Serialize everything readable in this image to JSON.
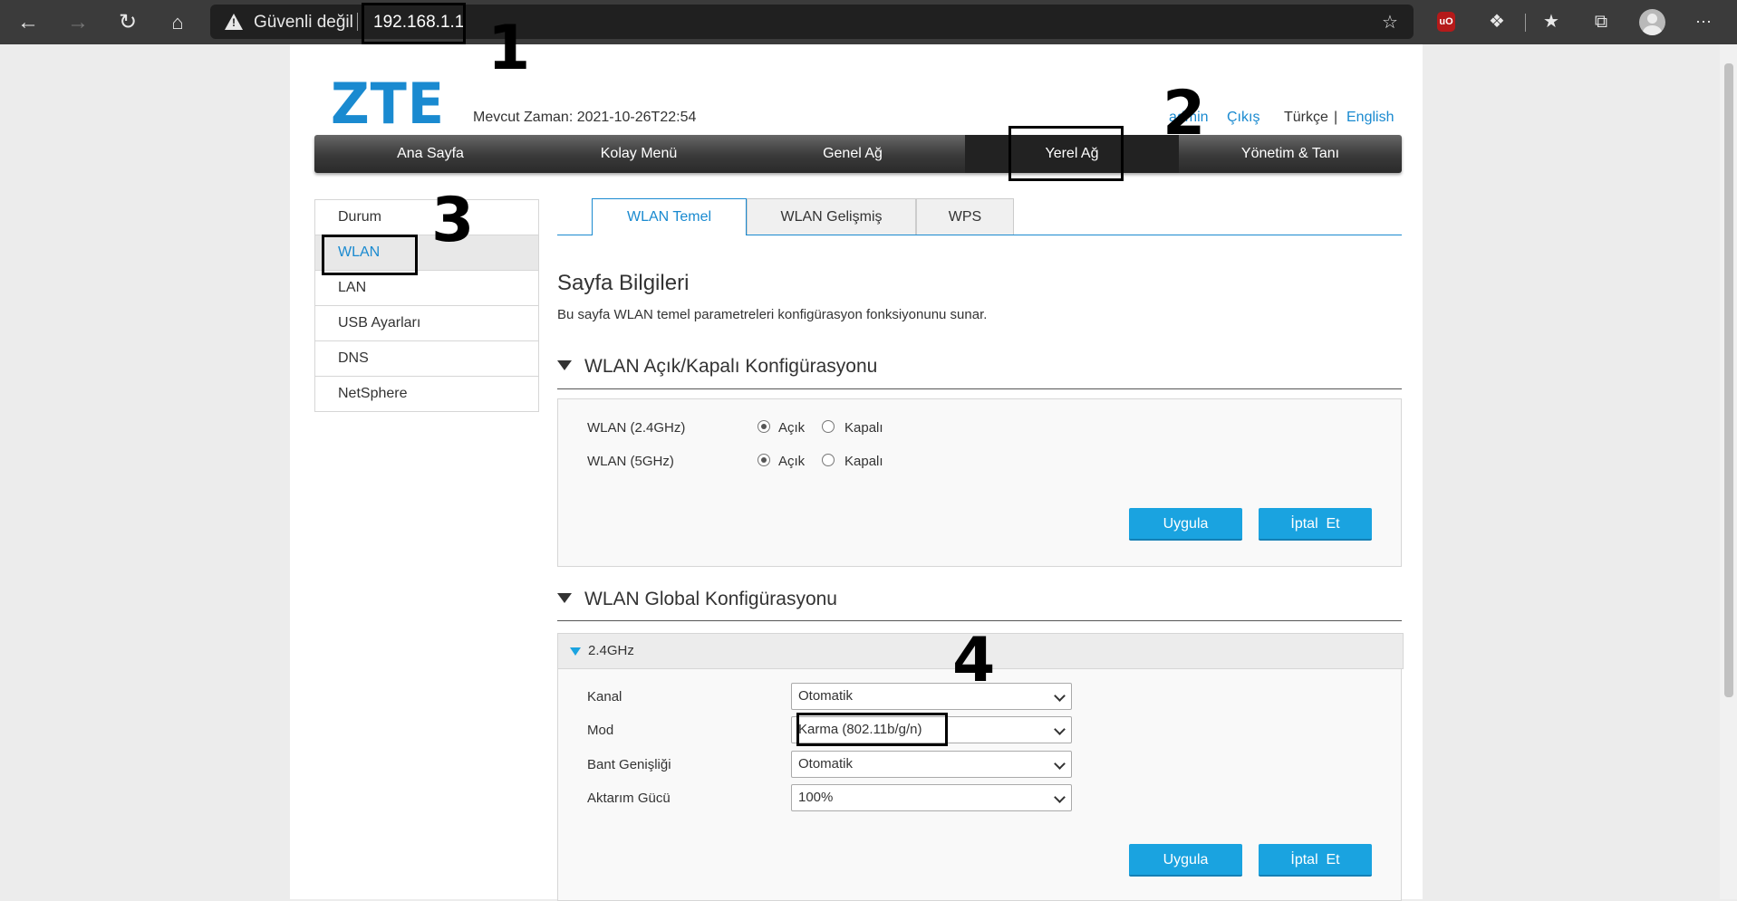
{
  "browser": {
    "security_label": "Güvenli değil",
    "url": "192.168.1.1",
    "ublock_label": "uO"
  },
  "header": {
    "logo": "ZTE",
    "current_time": "Mevcut Zaman: 2021-10-26T22:54",
    "user_link": "admin",
    "logout_link": "Çıkış",
    "lang_current": "Türkçe",
    "lang_sep": "|",
    "lang_other": "English"
  },
  "nav": {
    "items": [
      "Ana Sayfa",
      "Kolay Menü",
      "Genel Ağ",
      "Yerel Ağ",
      "Yönetim & Tanı"
    ],
    "active": "Yerel Ağ"
  },
  "sidebar": {
    "items": [
      "Durum",
      "WLAN",
      "LAN",
      "USB Ayarları",
      "DNS",
      "NetSphere"
    ],
    "active": "WLAN"
  },
  "tabs": {
    "items": [
      "WLAN Temel",
      "WLAN Gelişmiş",
      "WPS"
    ],
    "active": "WLAN Temel"
  },
  "page_info": {
    "title": "Sayfa Bilgileri",
    "description": "Bu sayfa WLAN temel parametreleri konfigürasyon fonksiyonunu sunar."
  },
  "onoff_section": {
    "title": "WLAN Açık/Kapalı Konfigürasyonu",
    "rows": [
      {
        "label": "WLAN (2.4GHz)",
        "on_label": "Açık",
        "off_label": "Kapalı",
        "selected": "Açık"
      },
      {
        "label": "WLAN (5GHz)",
        "on_label": "Açık",
        "off_label": "Kapalı",
        "selected": "Açık"
      }
    ],
    "apply_label": "Uygula",
    "cancel_label": "İptal  Et"
  },
  "global_section": {
    "title": "WLAN Global Konfigürasyonu",
    "band": "2.4GHz",
    "fields": [
      {
        "label": "Kanal",
        "value": "Otomatik"
      },
      {
        "label": "Mod",
        "value": "Karma (802.11b/g/n)"
      },
      {
        "label": "Bant Genişliği",
        "value": "Otomatik"
      },
      {
        "label": "Aktarım Gücü",
        "value": "100%"
      }
    ],
    "apply_label": "Uygula",
    "cancel_label": "İptal  Et"
  },
  "annotations": [
    "1",
    "2",
    "3",
    "4"
  ]
}
